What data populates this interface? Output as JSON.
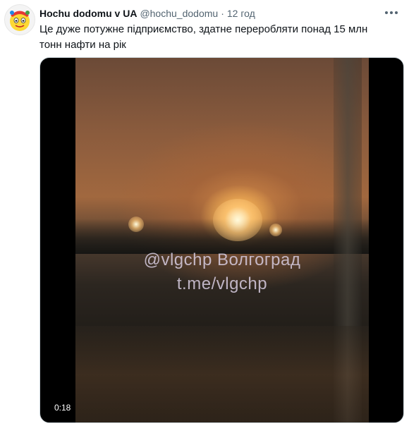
{
  "tweet": {
    "author_name": "Hochu dodomu v UA",
    "author_handle": "@hochu_dodomu",
    "separator": "·",
    "time": "12 год",
    "text": "Це дуже потужне підприємство, здатне переробляти понад 15 млн тонн нафти на рік",
    "avatar_icon": "cartoon-face-avatar-icon",
    "more_icon": "more-options-icon"
  },
  "media": {
    "type": "video",
    "watermark_line1": "@vlgchp Волгоград",
    "watermark_line2": "t.me/vlgchp",
    "duration": "0:18"
  },
  "colors": {
    "text_primary": "#0f1419",
    "text_secondary": "#536471",
    "border": "#cfd9de"
  }
}
